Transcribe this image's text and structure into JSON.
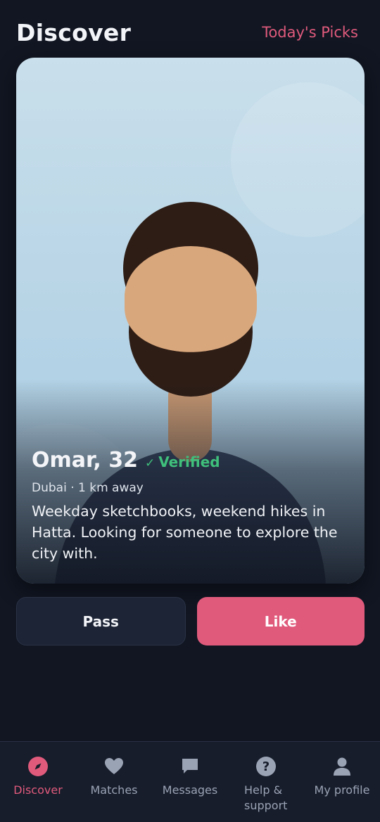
{
  "header": {
    "title": "Discover",
    "picks_label": "Today's Picks"
  },
  "profile": {
    "name_age": "Omar, 32",
    "verified_mark": "✓",
    "verified_label": "Verified",
    "location": "Dubai · 1 km away",
    "bio": "Weekday sketchbooks, weekend hikes in Hatta. Looking for someone to explore the city with."
  },
  "actions": {
    "pass_label": "Pass",
    "like_label": "Like"
  },
  "nav": {
    "items": [
      {
        "label": "Discover",
        "icon": "compass-icon",
        "active": true
      },
      {
        "label": "Matches",
        "icon": "heart-icon",
        "active": false
      },
      {
        "label": "Messages",
        "icon": "chat-bubble-icon",
        "active": false
      },
      {
        "label": "Help & support",
        "icon": "question-icon",
        "active": false
      },
      {
        "label": "My profile",
        "icon": "person-icon",
        "active": false
      }
    ]
  },
  "colors": {
    "background": "#111622",
    "accent": "#e05a7c",
    "verified": "#3fbf7b",
    "nav_inactive": "#9aa3b4"
  }
}
